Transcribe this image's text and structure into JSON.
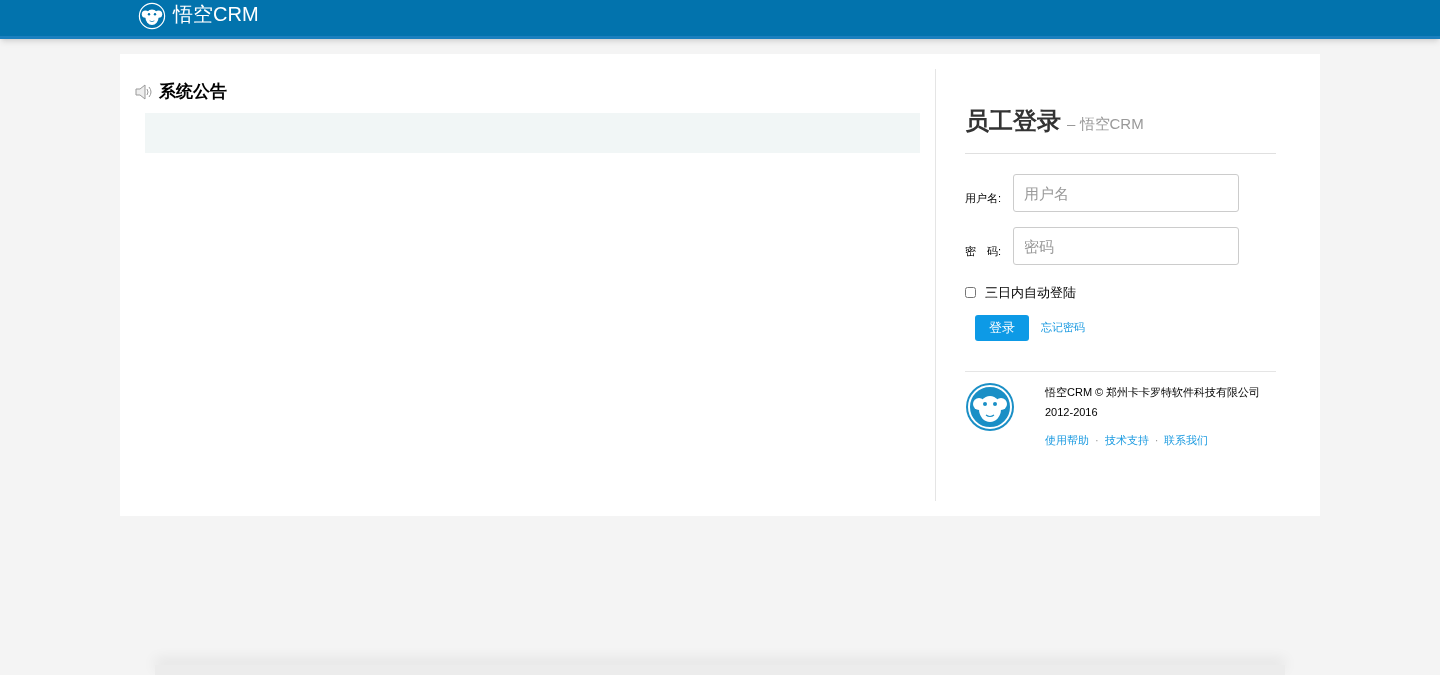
{
  "header": {
    "brand": "悟空CRM"
  },
  "announcement": {
    "title": "系统公告"
  },
  "login": {
    "title": "员工登录",
    "subtitle": "– 悟空CRM",
    "fields": [
      {
        "label": "用户名:",
        "placeholder": "用户名"
      },
      {
        "label": "密　码:",
        "placeholder": "密码"
      }
    ],
    "remember": {
      "label": "三日内自动登陆",
      "checked": false
    },
    "submit": "登录",
    "forgot": "忘记密码"
  },
  "footer": {
    "copyright": "悟空CRM © 郑州卡卡罗特软件科技有限公司 2012-2016",
    "links": [
      "使用帮助",
      "技术支持",
      "联系我们"
    ],
    "separator": "·"
  }
}
